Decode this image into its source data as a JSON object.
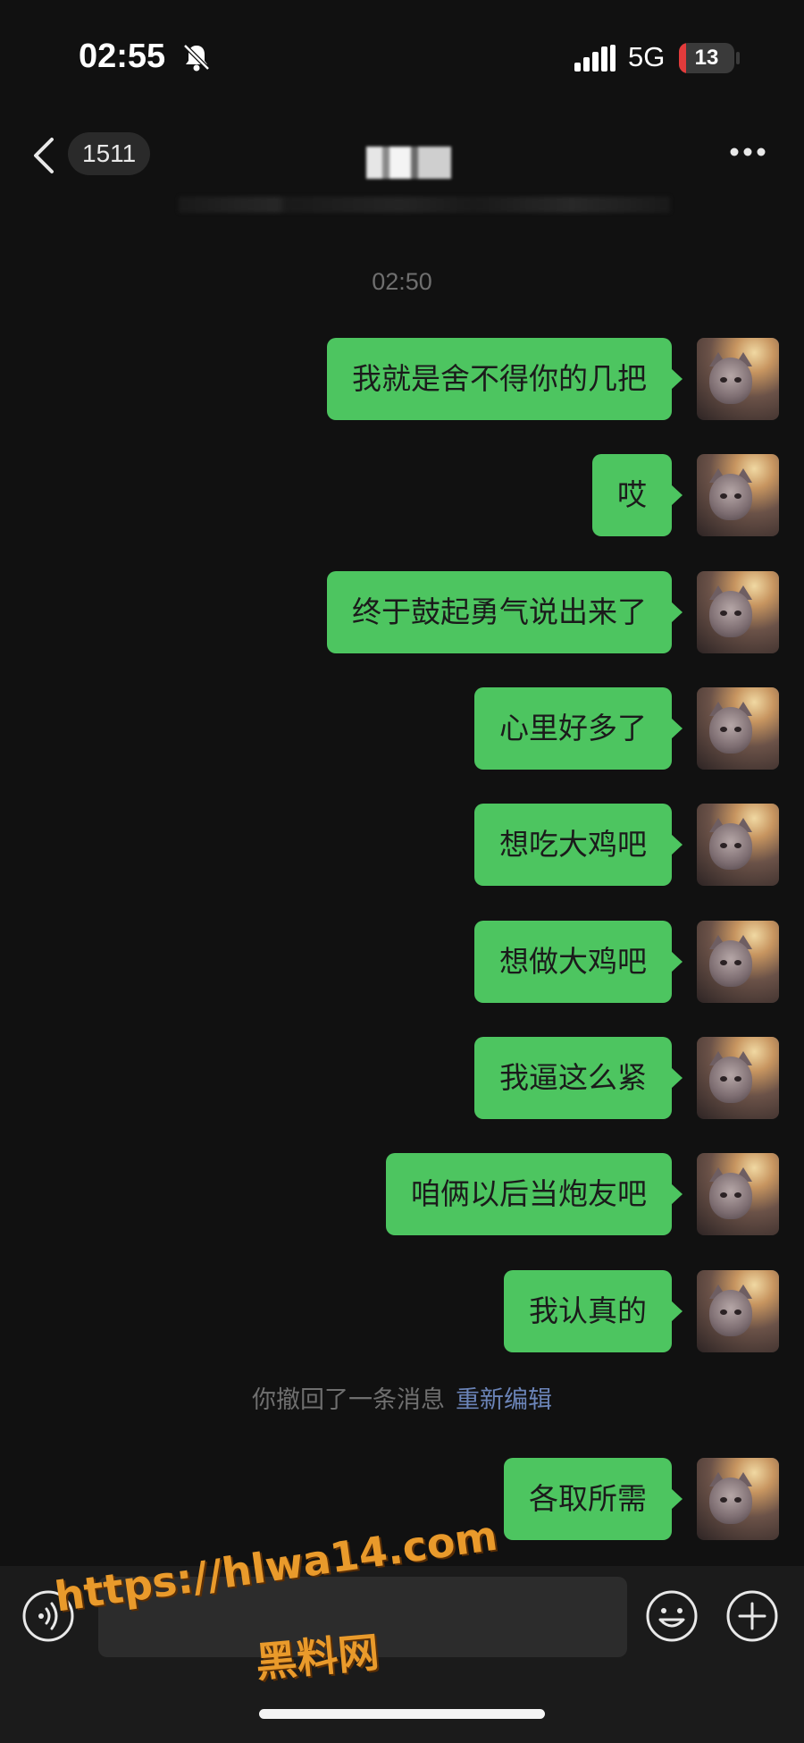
{
  "status_bar": {
    "time": "02:55",
    "network": "5G",
    "battery_level": 13,
    "battery_text": "13"
  },
  "header": {
    "back_badge": "1511",
    "title": ""
  },
  "chat": {
    "timestamp": "02:50",
    "messages": [
      {
        "text": "我就是舍不得你的几把"
      },
      {
        "text": "哎"
      },
      {
        "text": "终于鼓起勇气说出来了"
      },
      {
        "text": "心里好多了"
      },
      {
        "text": "想吃大鸡吧"
      },
      {
        "text": "想做大鸡吧"
      },
      {
        "text": "我逼这么紧"
      },
      {
        "text": "咱俩以后当炮友吧"
      },
      {
        "text": "我认真的"
      }
    ],
    "recall_notice": "你撤回了一条消息",
    "recall_edit_label": "重新编辑",
    "last_message": {
      "text": "各取所需"
    }
  },
  "input_bar": {
    "placeholder": ""
  },
  "watermark": {
    "url": "https://hlwa14.com",
    "name": "黑料网"
  },
  "colors": {
    "bubble": "#4dc560",
    "background": "#111111",
    "battery_low": "#e23b3b",
    "link": "#6b84b8",
    "watermark": "#e99a2b"
  }
}
